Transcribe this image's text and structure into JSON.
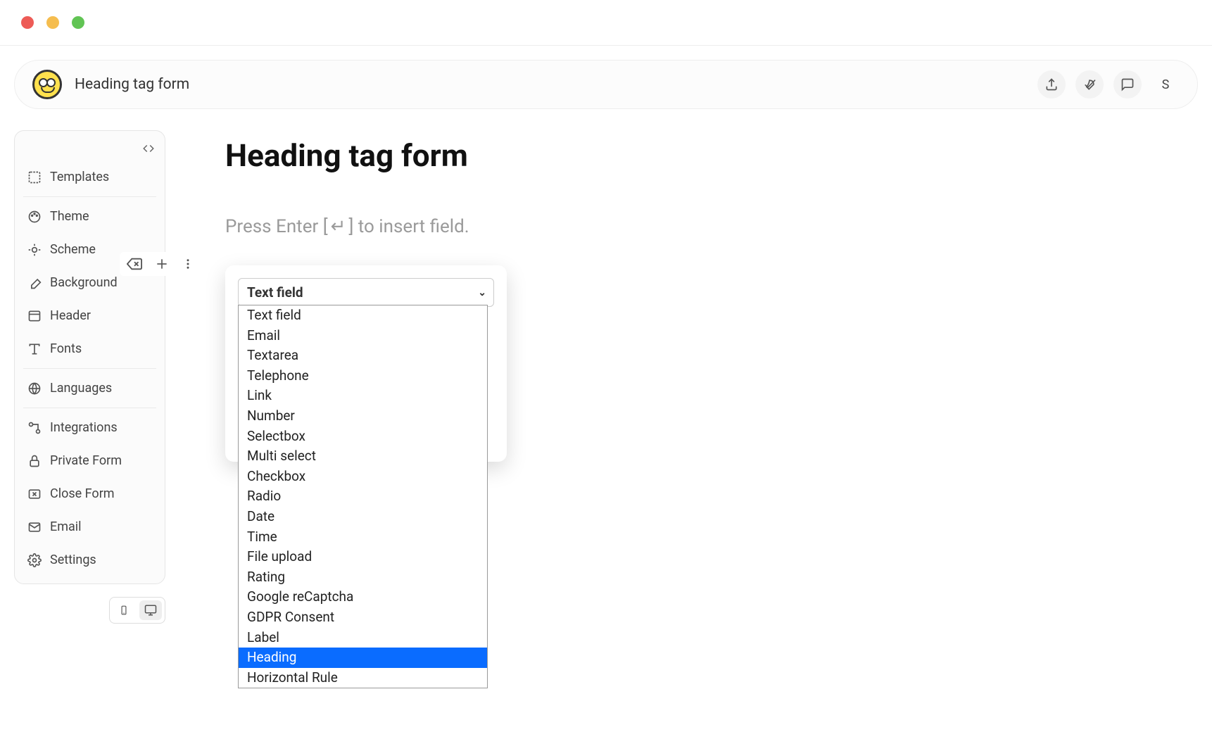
{
  "header": {
    "title": "Heading tag form",
    "avatar_initial": "S"
  },
  "sidebar": {
    "items": [
      {
        "label": "Templates"
      },
      {
        "label": "Theme"
      },
      {
        "label": "Scheme"
      },
      {
        "label": "Background"
      },
      {
        "label": "Header"
      },
      {
        "label": "Fonts"
      },
      {
        "label": "Languages"
      },
      {
        "label": "Integrations"
      },
      {
        "label": "Private Form"
      },
      {
        "label": "Close Form"
      },
      {
        "label": "Email"
      },
      {
        "label": "Settings"
      }
    ]
  },
  "main": {
    "form_title": "Heading tag form",
    "insert_hint_prefix": "Press Enter [",
    "insert_hint_key": "↵",
    "insert_hint_suffix": "] to insert field."
  },
  "field_select": {
    "selected": "Text field",
    "highlighted": "Heading",
    "options": [
      "Text field",
      "Email",
      "Textarea",
      "Telephone",
      "Link",
      "Number",
      "Selectbox",
      "Multi select",
      "Checkbox",
      "Radio",
      "Date",
      "Time",
      "File upload",
      "Rating",
      "Google reCaptcha",
      "GDPR Consent",
      "Label",
      "Heading",
      "Horizontal Rule"
    ]
  }
}
